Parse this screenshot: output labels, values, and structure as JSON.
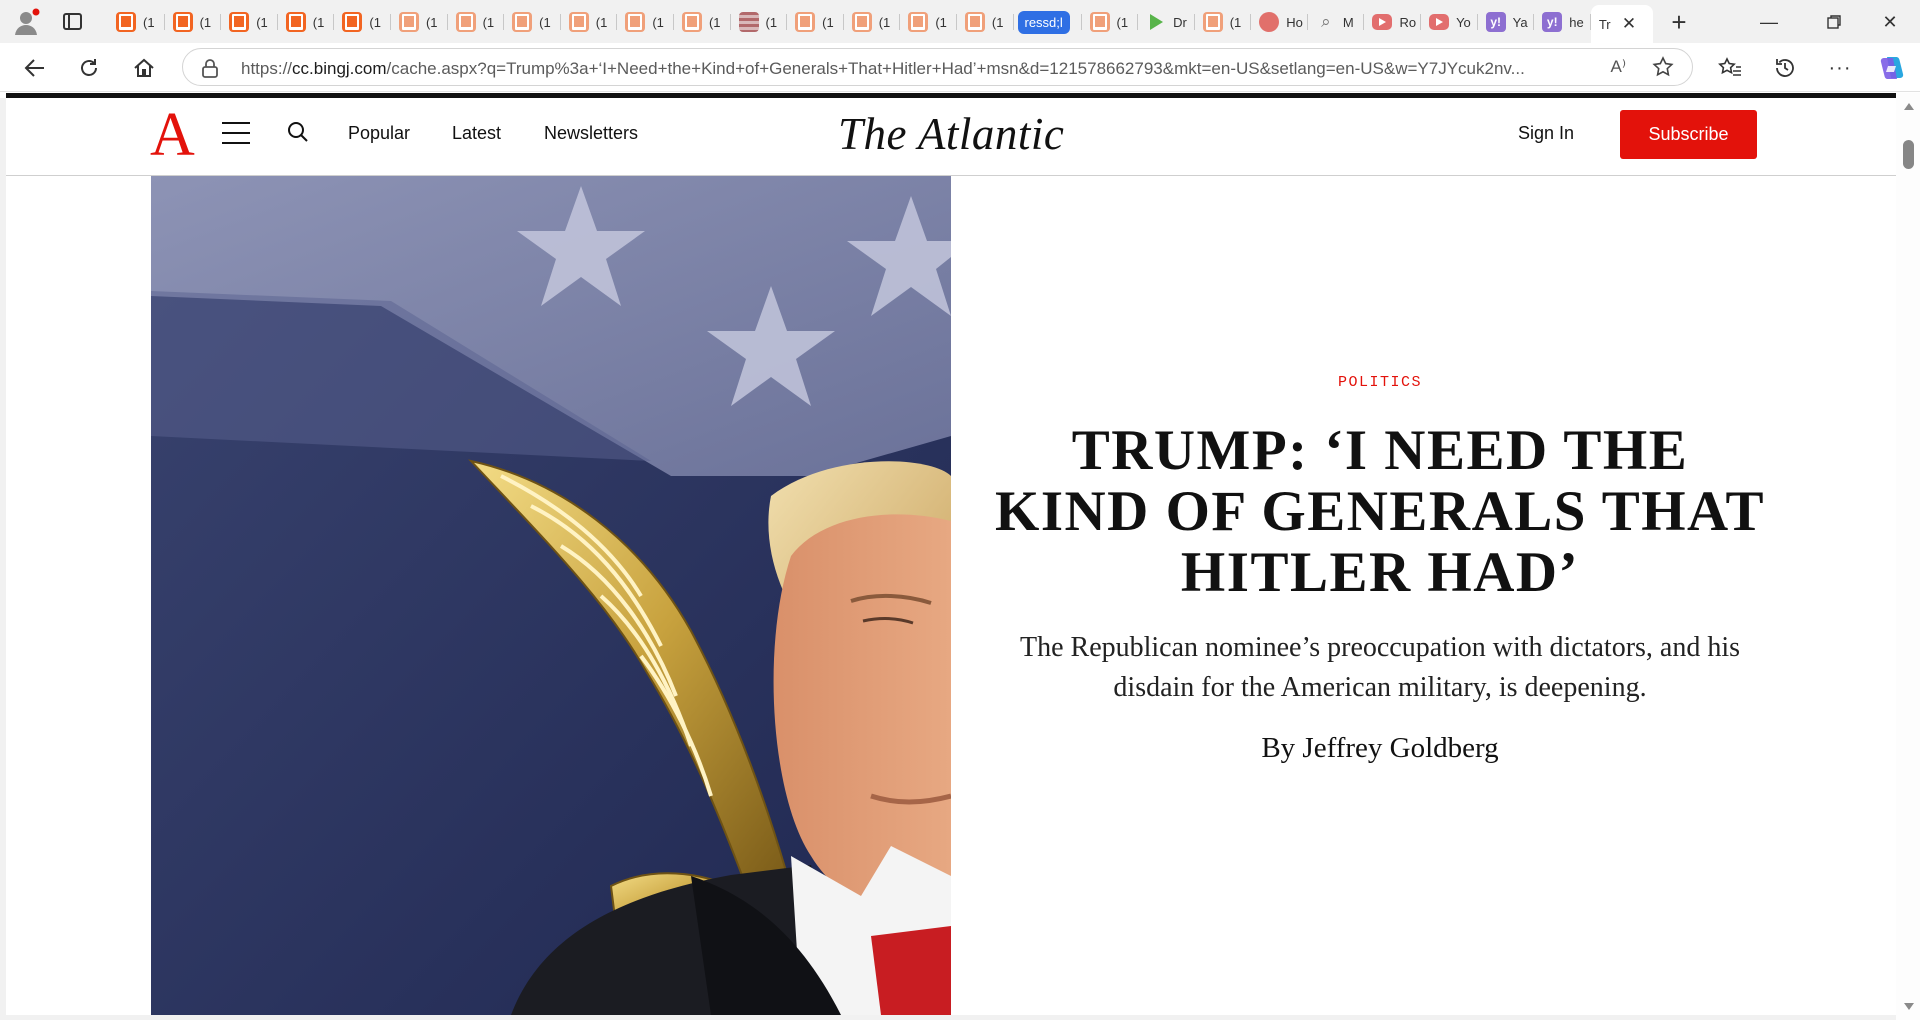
{
  "browser": {
    "tabs": [
      {
        "favicon": "bookmark-orange-icon",
        "title": "(1"
      },
      {
        "favicon": "bookmark-orange-icon",
        "title": "(1"
      },
      {
        "favicon": "bookmark-orange-icon",
        "title": "(1"
      },
      {
        "favicon": "bookmark-orange-icon",
        "title": "(1"
      },
      {
        "favicon": "bookmark-orange-icon",
        "title": "(1"
      },
      {
        "favicon": "bookmark-faded-icon",
        "title": "(1"
      },
      {
        "favicon": "bookmark-faded-icon",
        "title": "(1"
      },
      {
        "favicon": "bookmark-faded-icon",
        "title": "(1"
      },
      {
        "favicon": "bookmark-faded-icon",
        "title": "(1"
      },
      {
        "favicon": "bookmark-faded-icon",
        "title": "(1"
      },
      {
        "favicon": "bookmark-faded-icon",
        "title": "(1"
      },
      {
        "favicon": "striped-page-icon",
        "title": "(1"
      },
      {
        "favicon": "bookmark-faded-icon",
        "title": "(1"
      },
      {
        "favicon": "bookmark-faded-icon",
        "title": "(1"
      },
      {
        "favicon": "bookmark-faded-icon",
        "title": "(1"
      },
      {
        "favicon": "bookmark-faded-icon",
        "title": "(1"
      }
    ],
    "pill_tab": "ressd;l",
    "tabs_after": [
      {
        "favicon": "bookmark-faded-icon",
        "title": "(1"
      },
      {
        "favicon": "play-icon",
        "title": "Dr"
      },
      {
        "favicon": "bookmark-faded-icon",
        "title": "(1"
      },
      {
        "favicon": "microphone-icon",
        "title": "Ho"
      },
      {
        "favicon": "search-icon",
        "title": "M"
      },
      {
        "favicon": "youtube-icon",
        "title": "Ro"
      },
      {
        "favicon": "youtube-icon",
        "title": "Yo"
      },
      {
        "favicon": "yahoo-icon",
        "title": "Ya"
      },
      {
        "favicon": "yahoo-icon",
        "title": "he"
      }
    ],
    "active_tab": "Tr",
    "url_prefix": "https://",
    "url_host": "cc.bingj.com",
    "url_rest": "/cache.aspx?q=Trump%3a+‘I+Need+the+Kind+of+Generals+That+Hitler+Had’+msn&d=121578662793&mkt=en-US&setlang=en-US&w=Y7JYcuk2nv...",
    "read_aloud": "A⁾"
  },
  "site": {
    "logo": "A",
    "nav": [
      "Popular",
      "Latest",
      "Newsletters"
    ],
    "wordmark": "The Atlantic",
    "sign_in": "Sign In",
    "subscribe": "Subscribe"
  },
  "article": {
    "section": "POLITICS",
    "headline": "TRUMP: ‘I NEED THE KIND OF GENERALS THAT HITLER HAD’",
    "dek": "The Republican nominee’s preoccupation with dictators, and his disdain for the American military, is deepening.",
    "byline": "By Jeffrey Goldberg"
  },
  "colors": {
    "brand_red": "#e3120b",
    "tab_accent": "#2f6fe4"
  }
}
